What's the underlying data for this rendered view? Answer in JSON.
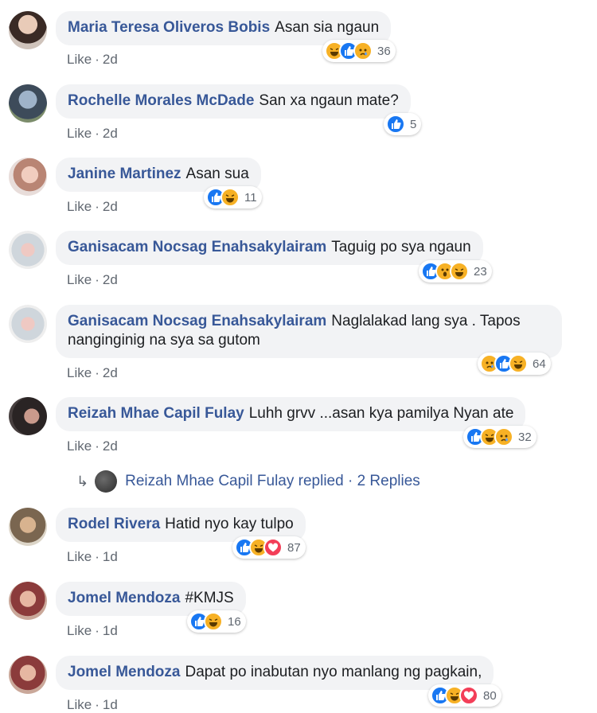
{
  "comments": [
    {
      "author": "Maria Teresa Oliveros Bobis",
      "text": "Asan sia ngaun",
      "like": "Like",
      "time": "2d",
      "reactions": [
        "haha",
        "like",
        "sad"
      ],
      "count": "36"
    },
    {
      "author": "Rochelle Morales McDade",
      "text": "San xa ngaun mate?",
      "like": "Like",
      "time": "2d",
      "reactions": [
        "like"
      ],
      "count": "5"
    },
    {
      "author": "Janine Martinez",
      "text": "Asan sua",
      "like": "Like",
      "time": "2d",
      "reactions": [
        "like",
        "haha"
      ],
      "count": "11"
    },
    {
      "author": "Ganisacam Nocsag Enahsakylairam",
      "text": "Taguig po sya ngaun",
      "like": "Like",
      "time": "2d",
      "reactions": [
        "like",
        "wow",
        "haha"
      ],
      "count": "23"
    },
    {
      "author": "Ganisacam Nocsag Enahsakylairam",
      "text": "Naglalakad lang sya . Tapos",
      "text2": "nanginginig na sya sa gutom",
      "like": "Like",
      "time": "2d",
      "reactions": [
        "sad",
        "like",
        "haha"
      ],
      "count": "64"
    },
    {
      "author": "Reizah Mhae Capil Fulay",
      "text": "Luhh grvv ...asan kya pamilya Nyan ate",
      "like": "Like",
      "time": "2d",
      "reactions": [
        "like",
        "haha",
        "sad"
      ],
      "count": "32"
    },
    {
      "author": "Rodel Rivera",
      "text": "Hatid nyo kay tulpo",
      "like": "Like",
      "time": "1d",
      "reactions": [
        "like",
        "haha",
        "love"
      ],
      "count": "87"
    },
    {
      "author": "Jomel Mendoza",
      "text": "#KMJS",
      "like": "Like",
      "time": "1d",
      "reactions": [
        "like",
        "haha"
      ],
      "count": "16"
    },
    {
      "author": "Jomel Mendoza",
      "text": "Dapat po inabutan nyo manlang ng pagkain,",
      "like": "Like",
      "time": "1d",
      "reactions": [
        "like",
        "haha",
        "love"
      ],
      "count": "80"
    }
  ],
  "replies": {
    "author": "Reizah Mhae Capil Fulay",
    "action": "replied",
    "separator": "·",
    "count_label": "2 Replies"
  },
  "colors": {
    "author": "#385898",
    "bubble": "#f2f3f5",
    "meta": "#606770",
    "like": "#1877f2",
    "haha": "#f7b125",
    "love": "#f33e58"
  }
}
